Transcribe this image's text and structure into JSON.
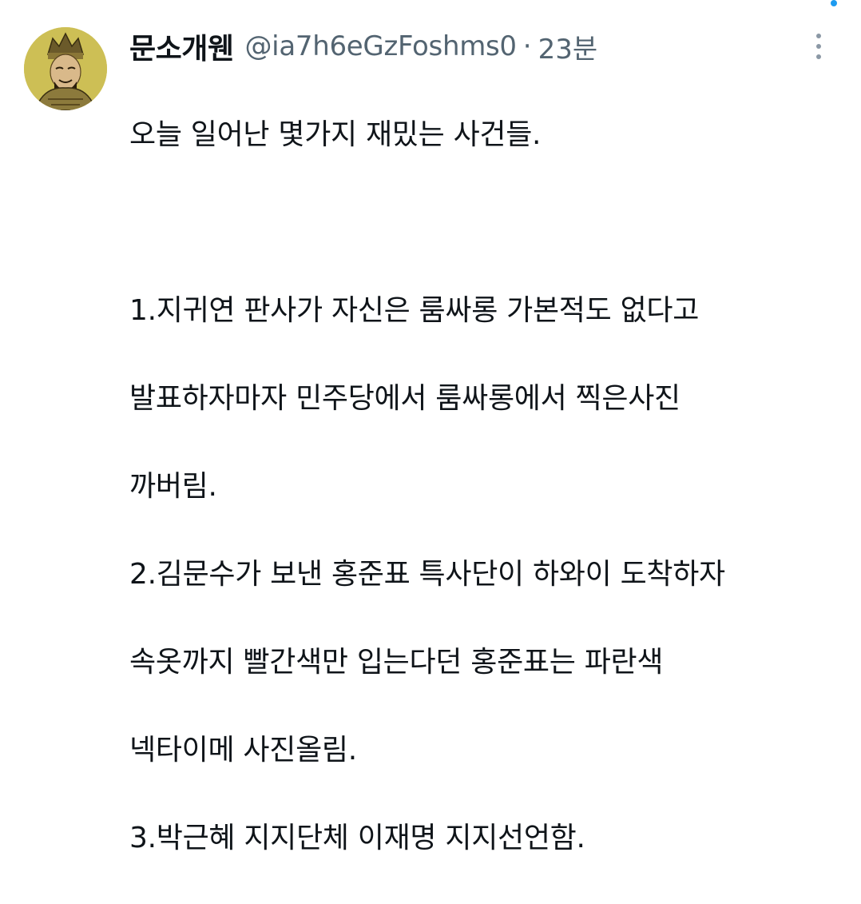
{
  "tweet": {
    "display_name": "문소개웬",
    "handle": "@ia7h6eGzFoshms0",
    "separator": "·",
    "time": "23분",
    "avatar_icon": "portrait-avatar-icon",
    "more_icon": "more-options-icon",
    "lines": [
      "오늘 일어난 몇가지 재밌는 사건들.",
      "",
      "1.지귀연 판사가 자신은 룸싸롱 가본적도 없다고",
      "발표하자마자 민주당에서 룸싸롱에서 찍은사진",
      "까버림.",
      "2.김문수가 보낸 홍준표 특사단이 하와이 도착하자",
      "속옷까지 빨간색만 입는다던 홍준표는 파란색",
      "넥타이메 사진올림.",
      "3.박근혜 지지단체 이재명 지지선언함."
    ]
  },
  "colors": {
    "text": "#0f1419",
    "secondary": "#536471",
    "accent": "#1d9bf0"
  }
}
